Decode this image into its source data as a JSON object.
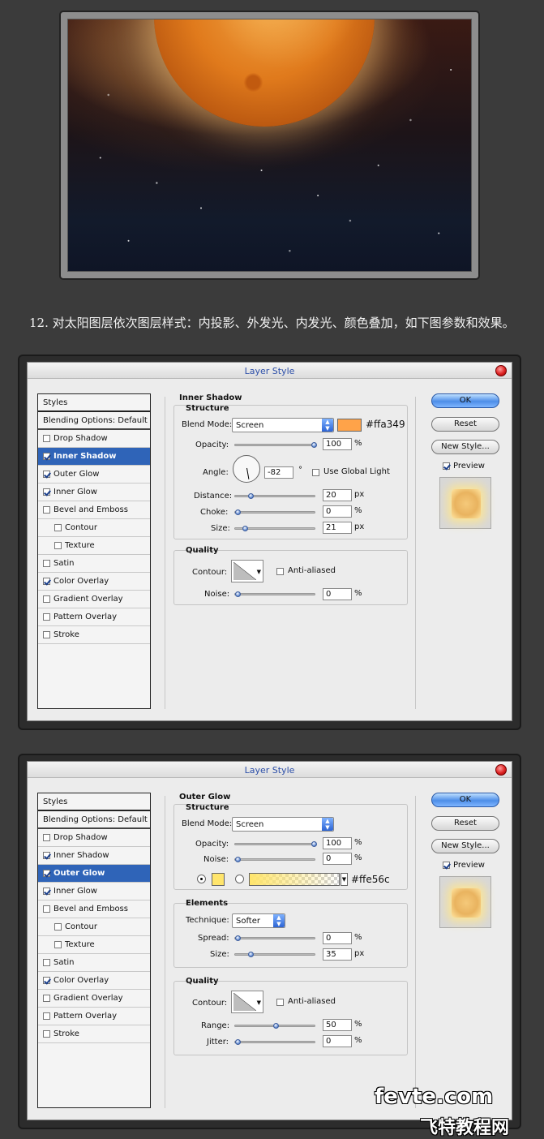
{
  "caption": "12. 对太阳图层依次图层样式：内投影、外发光、内发光、颜色叠加，如下图参数和效果。",
  "styles_header": "Styles",
  "blending_options": "Blending Options: Default",
  "style_items": [
    "Drop Shadow",
    "Inner Shadow",
    "Outer Glow",
    "Inner Glow",
    "Bevel and Emboss",
    "Contour",
    "Texture",
    "Satin",
    "Color Overlay",
    "Gradient Overlay",
    "Pattern Overlay",
    "Stroke"
  ],
  "buttons": {
    "ok": "OK",
    "reset": "Reset",
    "new_style": "New Style...",
    "preview": "Preview"
  },
  "dialog1": {
    "title": "Layer Style",
    "section": "Inner Shadow",
    "structure": "Structure",
    "blend_mode_label": "Blend Mode:",
    "blend_mode": "Screen",
    "color": "#ffa349",
    "color_label": "#ffa349",
    "opacity_label": "Opacity:",
    "opacity": "100",
    "angle_label": "Angle:",
    "angle": "-82",
    "degree": "°",
    "use_global_light": "Use Global Light",
    "distance_label": "Distance:",
    "distance": "20",
    "choke_label": "Choke:",
    "choke": "0",
    "size_label": "Size:",
    "size": "21",
    "quality": "Quality",
    "contour_label": "Contour:",
    "anti_aliased": "Anti-aliased",
    "noise_label": "Noise:",
    "noise": "0",
    "pct": "%",
    "px": "px"
  },
  "dialog2": {
    "title": "Layer Style",
    "section": "Outer Glow",
    "structure": "Structure",
    "blend_mode_label": "Blend Mode:",
    "blend_mode": "Screen",
    "opacity_label": "Opacity:",
    "opacity": "100",
    "noise_label": "Noise:",
    "noise": "0",
    "color": "#ffe56c",
    "color_label": "#ffe56c",
    "elements": "Elements",
    "technique_label": "Technique:",
    "technique": "Softer",
    "spread_label": "Spread:",
    "spread": "0",
    "size_label": "Size:",
    "size": "35",
    "quality": "Quality",
    "contour_label": "Contour:",
    "anti_aliased": "Anti-aliased",
    "range_label": "Range:",
    "range": "50",
    "jitter_label": "Jitter:",
    "jitter": "0",
    "pct": "%",
    "px": "px"
  },
  "watermark": {
    "site": "fevte.com",
    "name": "飞特教程网"
  }
}
